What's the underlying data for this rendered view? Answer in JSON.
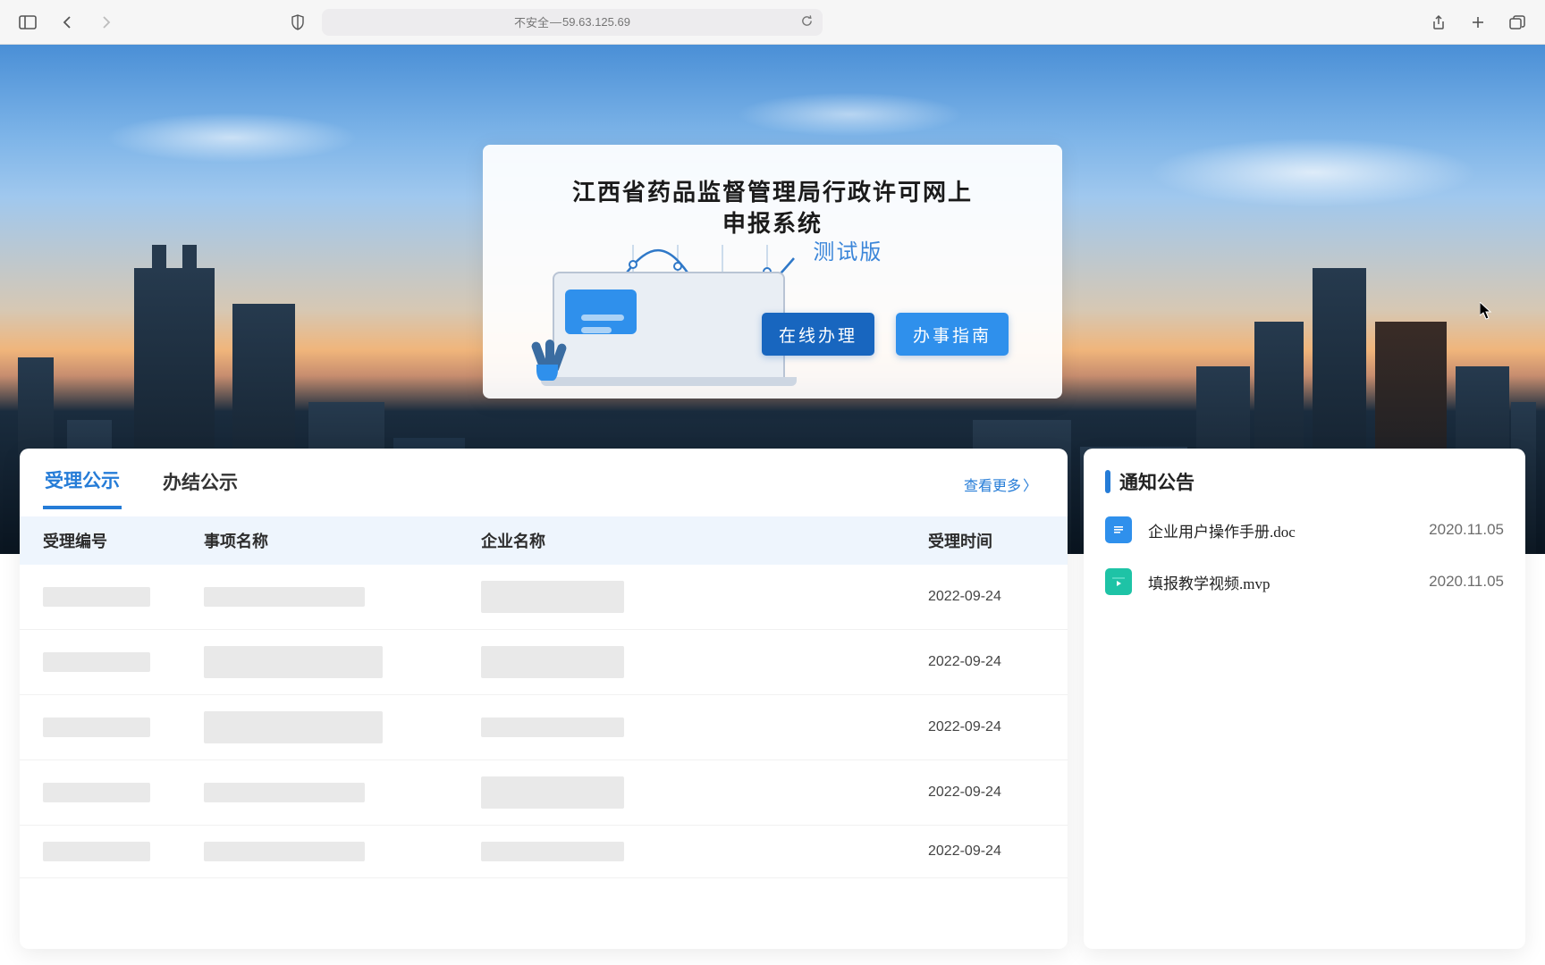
{
  "browser": {
    "address_prefix": "不安全",
    "address_host": "59.63.125.69"
  },
  "hero": {
    "title_line1": "江西省药品监督管理局行政许可网上",
    "title_line2": "申报系统",
    "subtitle": "测试版",
    "button_online": "在线办理",
    "button_guide": "办事指南"
  },
  "tabs": {
    "tab_accept": "受理公示",
    "tab_finished": "办结公示",
    "more": "查看更多"
  },
  "table": {
    "col_id": "受理编号",
    "col_item": "事项名称",
    "col_company": "企业名称",
    "col_date": "受理时间",
    "rows": [
      {
        "date": "2022-09-24"
      },
      {
        "date": "2022-09-24"
      },
      {
        "date": "2022-09-24"
      },
      {
        "date": "2022-09-24"
      },
      {
        "date": "2022-09-24"
      }
    ]
  },
  "notice": {
    "title": "通知公告",
    "files": [
      {
        "name": "企业用户操作手册.doc",
        "date": "2020.11.05",
        "type": "doc"
      },
      {
        "name": "填报教学视频.mvp",
        "date": "2020.11.05",
        "type": "video"
      }
    ]
  }
}
